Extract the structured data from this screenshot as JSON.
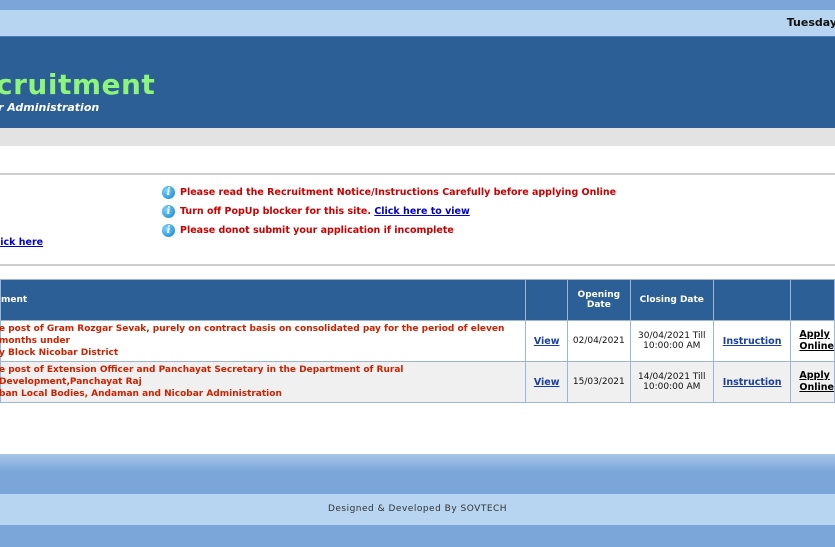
{
  "header": {
    "date": "Tuesday",
    "title": "cruitment",
    "subtitle": "r Administration"
  },
  "notices": {
    "items": [
      {
        "text": "Please read the Recruitment Notice/Instructions Carefully before applying Online"
      },
      {
        "text": "Turn off PopUp blocker for this site.",
        "link": "Click here to view"
      },
      {
        "text": "Please donot submit your application if incomplete"
      }
    ],
    "left_link": "lick here"
  },
  "table": {
    "headers": {
      "post": "ment",
      "view": "",
      "opening_line1": "Opening",
      "opening_line2": "Date",
      "closing": "Closing Date",
      "instruction": "",
      "apply": ""
    },
    "rows": [
      {
        "post_line1": "e post of Gram Rozgar Sevak, purely on contract basis on consolidated pay for the period of eleven months under",
        "post_line2": "y Block Nicobar District",
        "view": "View",
        "opening": "02/04/2021",
        "closing_line1": "30/04/2021 Till",
        "closing_line2": "10:00:00 AM",
        "instruction": "Instruction",
        "apply_line1": "Apply",
        "apply_line2": "Online"
      },
      {
        "post_line1": "e post of Extension Officer and Panchayat Secretary in the Department of Rural Development,Panchayat Raj",
        "post_line2": "ban Local Bodies, Andaman and Nicobar Administration",
        "view": "View",
        "opening": "15/03/2021",
        "closing_line1": "14/04/2021 Till",
        "closing_line2": "10:00:00 AM",
        "instruction": "Instruction",
        "apply_line1": "Apply",
        "apply_line2": "Online"
      }
    ]
  },
  "footer": {
    "text": "Designed & Developed By SOVTECH"
  }
}
